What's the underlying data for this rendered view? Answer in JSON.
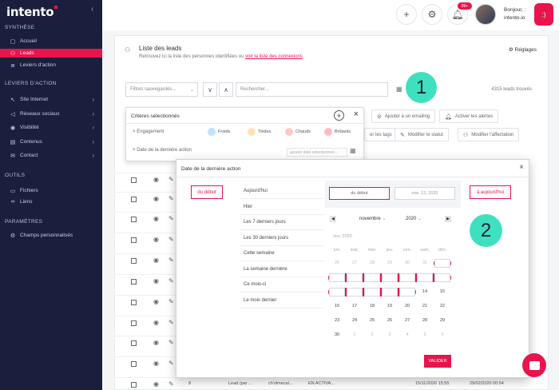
{
  "app": {
    "logo": "intento"
  },
  "sidebar": {
    "sections": [
      {
        "title": "SYNTHÈSE"
      },
      {
        "title": "LEVIERS D'ACTION"
      },
      {
        "title": "OUTILS"
      },
      {
        "title": "PARAMÈTRES"
      }
    ],
    "items": [
      {
        "label": "Accueil",
        "icon": "home-icon"
      },
      {
        "label": "Leads",
        "icon": "users-icon"
      },
      {
        "label": "Leviers d'action",
        "icon": "list-icon"
      },
      {
        "label": "Site Internet",
        "icon": "cursor-icon"
      },
      {
        "label": "Réseaux sociaux",
        "icon": "megaphone-icon"
      },
      {
        "label": "Visibilité",
        "icon": "eye-icon"
      },
      {
        "label": "Contenus",
        "icon": "file-icon"
      },
      {
        "label": "Contact",
        "icon": "mail-icon"
      },
      {
        "label": "Fichiers",
        "icon": "folder-icon"
      },
      {
        "label": "Liens",
        "icon": "link-icon"
      },
      {
        "label": "Champs personnalisés",
        "icon": "gear-icon"
      }
    ]
  },
  "topbar": {
    "notif_count": "99+",
    "greeting": "Bonjour, :",
    "company": "intento.io",
    "logout_icon": ":)"
  },
  "main": {
    "title": "Liste des leads",
    "subtitle": "Retrouvez ici la liste des personnes identifiées ou",
    "subtitle_link": "voir la liste des connexions",
    "settings_label": "Réglages",
    "saved_filters_placeholder": "Filtres sauvegardés...",
    "search_placeholder": "Rechercher...",
    "count": "4315 leads trouvés",
    "actions": {
      "emailing": "Ajouter à un emailing",
      "alerts": "Activer les alertes",
      "tags": "er les tags",
      "status": "Modifier le statut",
      "assign": "Modifier l'affectation"
    }
  },
  "criteria": {
    "title": "Critères sélectionnés",
    "engagement_label": "Engagement",
    "chips": [
      {
        "label": "Froids",
        "color": "#bfe3ff"
      },
      {
        "label": "Tièdes",
        "color": "#ffe1b8"
      },
      {
        "label": "Chauds",
        "color": "#ffc9c4"
      },
      {
        "label": "Brûlants",
        "color": "#ffb9c8"
      }
    ],
    "date_label": "Date de la dernière action",
    "date_placeholder": "ajouter date sélectionnée..."
  },
  "dialog": {
    "title": "Date de la dernière action",
    "btn_start": "du début",
    "btn_today": "à aujourd'hui",
    "presets": [
      "Aujourd'hui",
      "Hier",
      "Les 7 derniers jours",
      "Les 30 derniers jours",
      "Cette semaine",
      "La semaine dernière",
      "Ce mois-ci",
      "Le mois dernier"
    ],
    "from_value": "du début",
    "to_value": "nov. 12, 2020",
    "month": "novembre",
    "year": "2020",
    "month_label": "nov. 2020",
    "weekdays": [
      "lun.",
      "mar.",
      "mer.",
      "jeu.",
      "ven.",
      "sam.",
      "dim."
    ],
    "weeks": [
      [
        "26",
        "27",
        "28",
        "29",
        "30",
        "31",
        "1"
      ],
      [
        "2",
        "3",
        "4",
        "5",
        "6",
        "7",
        "8"
      ],
      [
        "9",
        "10",
        "11",
        "12",
        "13",
        "14",
        "15"
      ],
      [
        "16",
        "17",
        "18",
        "19",
        "20",
        "21",
        "22"
      ],
      [
        "23",
        "24",
        "25",
        "26",
        "27",
        "28",
        "29"
      ],
      [
        "30",
        "1",
        "2",
        "3",
        "4",
        "5",
        "6"
      ]
    ],
    "validate": "VALIDER"
  },
  "bottom_row": {
    "num": "8",
    "lead": "Lead (par ...",
    "company": "ch'olmecal...",
    "status": "EN ACTIVA...",
    "date1": "15/11/2020 15:55",
    "date2": "29/02/2020 00:54"
  },
  "markers": {
    "one": "1",
    "two": "2"
  },
  "colors": {
    "accent": "#e8144c",
    "sidebar": "#1a1f3d",
    "marker": "#3fe0c0"
  }
}
